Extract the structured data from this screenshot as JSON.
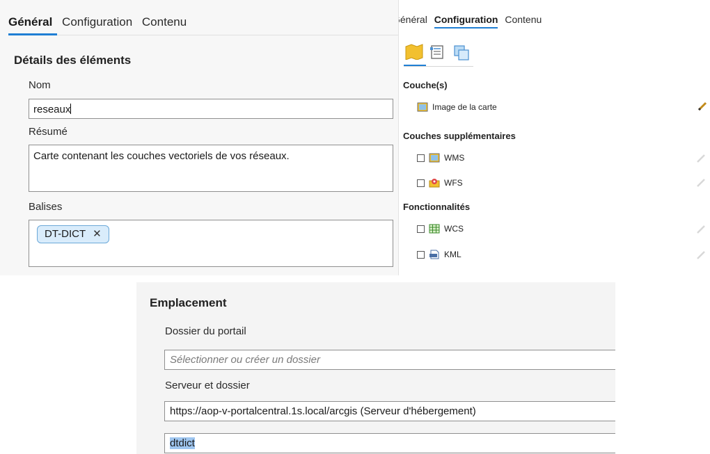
{
  "left": {
    "tabs": [
      {
        "label": "Général",
        "active": true
      },
      {
        "label": "Configuration",
        "active": false
      },
      {
        "label": "Contenu",
        "active": false
      }
    ],
    "section_title": "Détails des éléments",
    "name_label": "Nom",
    "name_value": "reseaux",
    "summary_label": "Résumé",
    "summary_value": "Carte contenant les couches vectoriels de vos réseaux.",
    "tags_label": "Balises",
    "tags": [
      "DT-DICT"
    ],
    "tag_remove_glyph": "✕"
  },
  "right": {
    "tabs": [
      {
        "label": "Général",
        "active": false
      },
      {
        "label": "Configuration",
        "active": true
      },
      {
        "label": "Contenu",
        "active": false
      }
    ],
    "icon_tabs": [
      "map-icon",
      "properties-icon",
      "layers-icon"
    ],
    "groups": {
      "layers": "Couche(s)",
      "additional_layers": "Couches supplémentaires",
      "capabilities": "Fonctionnalités"
    },
    "items": {
      "map_image": "Image de la carte",
      "wms": "WMS",
      "wfs": "WFS",
      "wcs": "WCS",
      "kml": "KML"
    }
  },
  "bottom": {
    "section_title": "Emplacement",
    "portal_folder_label": "Dossier du portail",
    "portal_folder_placeholder": "Sélectionner ou créer un dossier",
    "server_label": "Serveur et dossier",
    "server_value": "https://aop-v-portalcentral.1s.local/arcgis (Serveur d'hébergement)",
    "server_folder_value": "dtdict"
  },
  "colors": {
    "accent": "#1f7fd4",
    "tag_bg": "#d9ecfb",
    "selection": "#9fc6f0"
  }
}
